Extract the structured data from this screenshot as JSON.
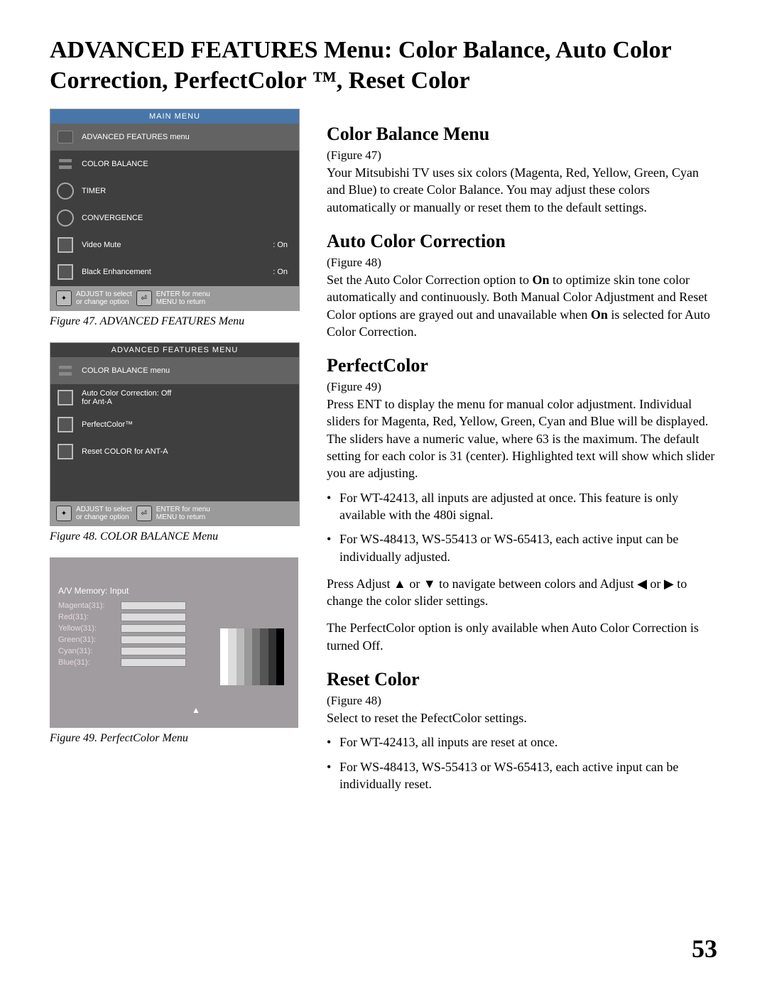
{
  "title": "ADVANCED FEATURES Menu: Color Balance, Auto Color Correction, PerfectColor ™, Reset Color",
  "page_number": "53",
  "fig47": {
    "title": "MAIN MENU",
    "items": [
      {
        "label": "ADVANCED FEATURES menu"
      },
      {
        "label": "COLOR BALANCE"
      },
      {
        "label": "TIMER"
      },
      {
        "label": "CONVERGENCE"
      },
      {
        "label": "Video Mute",
        "val": ": On"
      },
      {
        "label": "Black Enhancement",
        "val": ": On"
      }
    ],
    "footer_left": "ADJUST to select\nor change option",
    "footer_mid": "ENTER for menu",
    "footer_right": "MENU to return",
    "caption": "Figure 47. ADVANCED FEATURES Menu"
  },
  "fig48": {
    "title": "ADVANCED FEATURES MENU",
    "items": [
      {
        "label": "COLOR BALANCE menu"
      },
      {
        "label": "Auto Color Correction: Off\nfor Ant-A"
      },
      {
        "label": "PerfectColor™"
      },
      {
        "label": "Reset COLOR for ANT-A"
      }
    ],
    "footer_left": "ADJUST to select\nor change option",
    "footer_mid": "ENTER for menu",
    "footer_right": "MENU to return",
    "caption": "Figure 48.  COLOR BALANCE Menu"
  },
  "fig49": {
    "title": "A/V Memory: Input",
    "rows": [
      "Magenta(31):",
      "Red(31):",
      "Yellow(31):",
      "Green(31):",
      "Cyan(31):",
      "Blue(31):"
    ],
    "caption": "Figure 49.  PerfectColor Menu"
  },
  "sections": {
    "cbm": {
      "h": "Color Balance Menu",
      "ref": "(Figure 47)",
      "p": "Your Mitsubishi TV uses six colors (Magenta, Red, Yellow, Green, Cyan and Blue) to create Color Balance.  You may adjust these colors automatically or manually or reset them to the default settings."
    },
    "acc": {
      "h": "Auto Color Correction",
      "ref": "(Figure 48)",
      "p1a": "Set the Auto Color Correction option to ",
      "p1b": "On",
      "p1c": " to optimize skin tone color automatically and continuously.  Both Manual Color Adjustment and Reset Color options are grayed out and unavailable when ",
      "p1d": "On",
      "p1e": " is selected for Auto Color Correction."
    },
    "pc": {
      "h": "PerfectColor",
      "ref": "(Figure 49)",
      "p1": "Press ENT to display the menu for manual color adjustment.  Individual sliders for Magenta, Red, Yellow, Green, Cyan and Blue will be displayed.  The sliders have a numeric value, where 63 is the maximum. The default setting for each color is 31 (center).  Highlighted text will show which slider you are adjusting.",
      "b1": "For WT-42413, all inputs are adjusted at once.  This feature is only available with the 480i signal.",
      "b2": "For WS-48413, WS-55413 or WS-65413, each active input can be individually adjusted.",
      "p2": "Press Adjust  ▲ or  ▼  to navigate between colors and Adjust ◀ or ▶  to change the color slider settings.",
      "p3": "The PerfectColor option is only available when Auto Color Correction is turned Off."
    },
    "rc": {
      "h": "Reset Color",
      "ref": "(Figure 48)",
      "p": "Select to reset the PefectColor settings.",
      "b1": "For WT-42413,  all inputs are reset at once.",
      "b2": "For WS-48413, WS-55413 or WS-65413, each active input can be individually reset."
    }
  }
}
